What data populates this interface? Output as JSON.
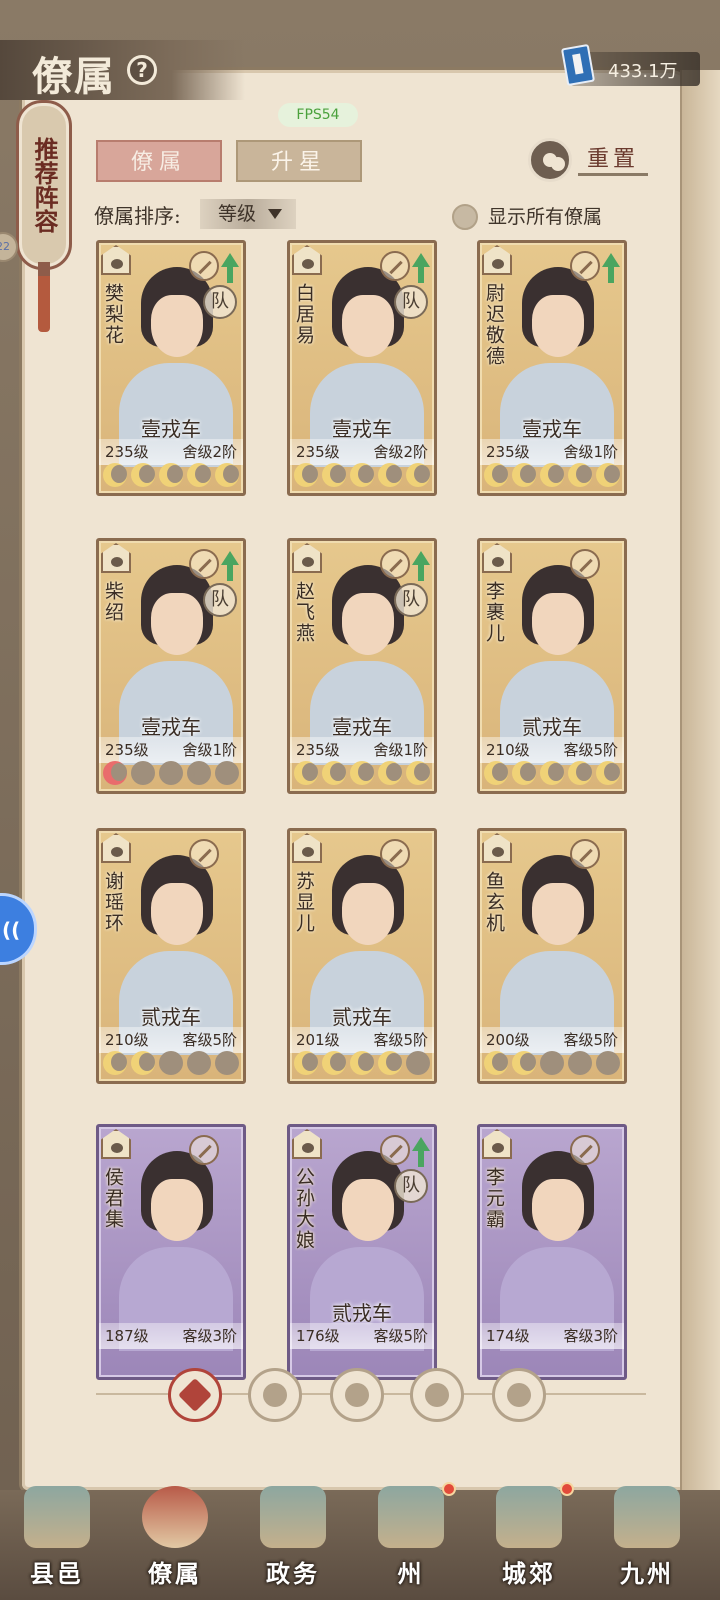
{
  "header": {
    "title": "僚属",
    "help_icon": "question-icon",
    "currency": {
      "icon": "blue-book-icon",
      "value": "433.1万"
    },
    "fps": "FPS54"
  },
  "side": {
    "recommend_label": "推荐阵容",
    "left_tab_badge": "22"
  },
  "tabs": [
    {
      "label": "僚属",
      "active": true
    },
    {
      "label": "升星",
      "active": false
    }
  ],
  "reset_label": "重置",
  "sort": {
    "label": "僚属排序:",
    "selected": "等级",
    "show_all_label": "显示所有僚属"
  },
  "cards": [
    {
      "name": "樊梨花",
      "cart": "壹戎车",
      "level": "235级",
      "house": "舍级2阶",
      "team": "队",
      "upgrade": true,
      "stars": 5,
      "frame": "gold"
    },
    {
      "name": "白居易",
      "cart": "壹戎车",
      "level": "235级",
      "house": "舍级2阶",
      "team": "队",
      "upgrade": true,
      "stars": 5,
      "frame": "gold"
    },
    {
      "name": "尉迟敬德",
      "cart": "壹戎车",
      "level": "235级",
      "house": "舍级1阶",
      "team": "",
      "upgrade": true,
      "stars": 5,
      "frame": "gold"
    },
    {
      "name": "柴绍",
      "cart": "壹戎车",
      "level": "235级",
      "house": "舍级1阶",
      "team": "队",
      "upgrade": true,
      "stars": 1,
      "frame": "gold"
    },
    {
      "name": "赵飞燕",
      "cart": "壹戎车",
      "level": "235级",
      "house": "舍级1阶",
      "team": "队",
      "upgrade": true,
      "stars": 5,
      "frame": "gold"
    },
    {
      "name": "李裹儿",
      "cart": "贰戎车",
      "level": "210级",
      "house": "客级5阶",
      "team": "",
      "upgrade": false,
      "stars": 5,
      "frame": "gold"
    },
    {
      "name": "谢瑶环",
      "cart": "贰戎车",
      "level": "210级",
      "house": "客级5阶",
      "team": "",
      "upgrade": false,
      "stars": 2,
      "frame": "gold"
    },
    {
      "name": "苏显儿",
      "cart": "贰戎车",
      "level": "201级",
      "house": "客级5阶",
      "team": "",
      "upgrade": false,
      "stars": 4,
      "frame": "gold"
    },
    {
      "name": "鱼玄机",
      "cart": "",
      "level": "200级",
      "house": "客级5阶",
      "team": "",
      "upgrade": false,
      "stars": 2,
      "frame": "gold"
    },
    {
      "name": "侯君集",
      "cart": "",
      "level": "187级",
      "house": "客级3阶",
      "team": "",
      "upgrade": false,
      "stars": 0,
      "frame": "purple"
    },
    {
      "name": "公孙大娘",
      "cart": "贰戎车",
      "level": "176级",
      "house": "客级5阶",
      "team": "队",
      "upgrade": true,
      "stars": 0,
      "frame": "purple"
    },
    {
      "name": "李元霸",
      "cart": "",
      "level": "174级",
      "house": "客级3阶",
      "team": "",
      "upgrade": false,
      "stars": 0,
      "frame": "purple"
    }
  ],
  "filters": [
    "all-filter-icon",
    "helmet-filter-icon",
    "gourd-filter-icon",
    "fan-filter-icon",
    "beast-filter-icon"
  ],
  "nav": [
    {
      "label": "县邑",
      "active": false,
      "dot": false
    },
    {
      "label": "僚属",
      "active": true,
      "dot": false
    },
    {
      "label": "政务",
      "active": false,
      "dot": false
    },
    {
      "label": "州",
      "active": false,
      "dot": true
    },
    {
      "label": "城郊",
      "active": false,
      "dot": true
    },
    {
      "label": "九州",
      "active": false,
      "dot": false
    }
  ]
}
